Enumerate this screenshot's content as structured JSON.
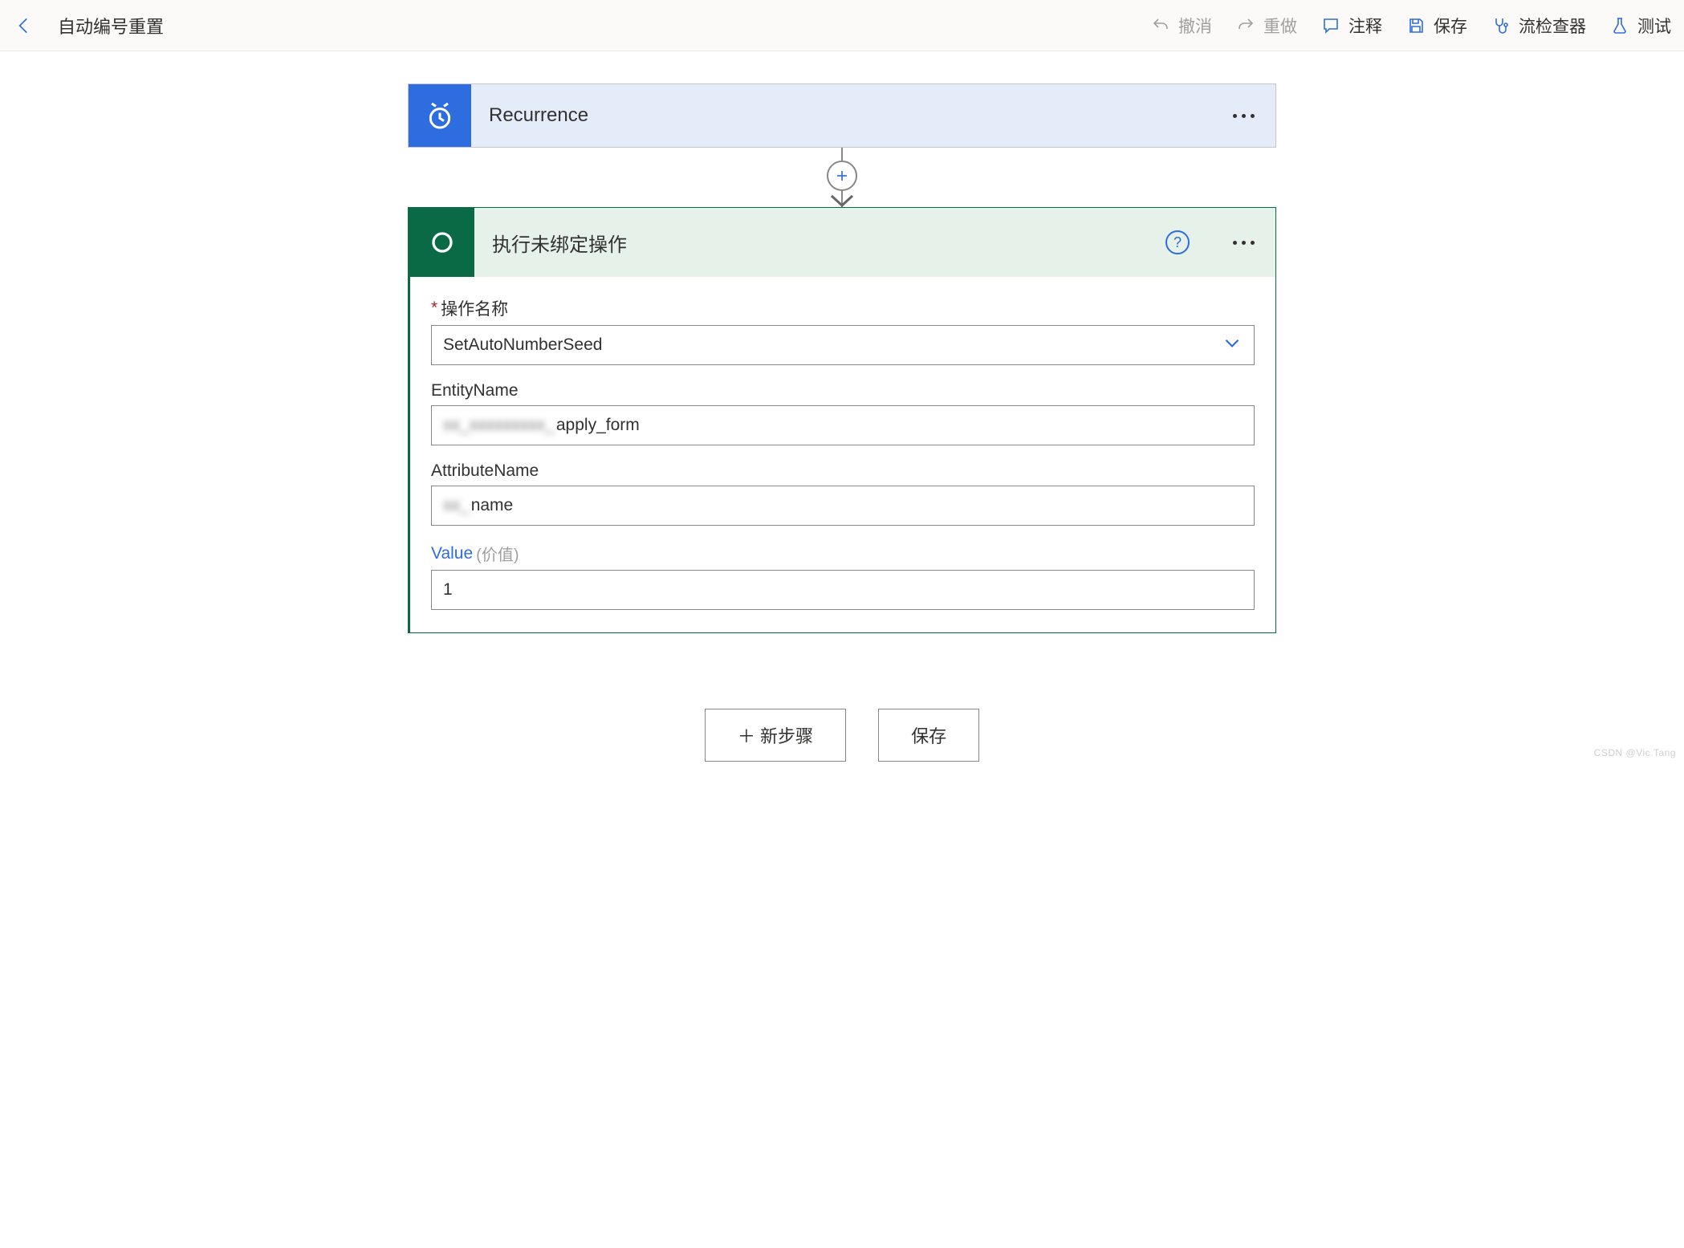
{
  "header": {
    "title": "自动编号重置"
  },
  "toolbar": {
    "undo": "撤消",
    "redo": "重做",
    "comment": "注释",
    "save": "保存",
    "checker": "流检查器",
    "test": "测试"
  },
  "cards": {
    "recurrence": {
      "title": "Recurrence"
    },
    "action": {
      "title": "执行未绑定操作",
      "fields": {
        "operation": {
          "label": "操作名称",
          "value": "SetAutoNumberSeed"
        },
        "entityName": {
          "label": "EntityName",
          "prefix_blurred": "xx_xxxxxxxxx_",
          "suffix": "apply_form"
        },
        "attributeName": {
          "label": "AttributeName",
          "prefix_blurred": "xx_",
          "suffix": "name"
        },
        "value": {
          "label": "Value",
          "paren": "(价值)",
          "value": "1"
        }
      }
    }
  },
  "footer": {
    "newStep": "新步骤",
    "save": "保存"
  },
  "watermark": "CSDN @Vic.Tang"
}
